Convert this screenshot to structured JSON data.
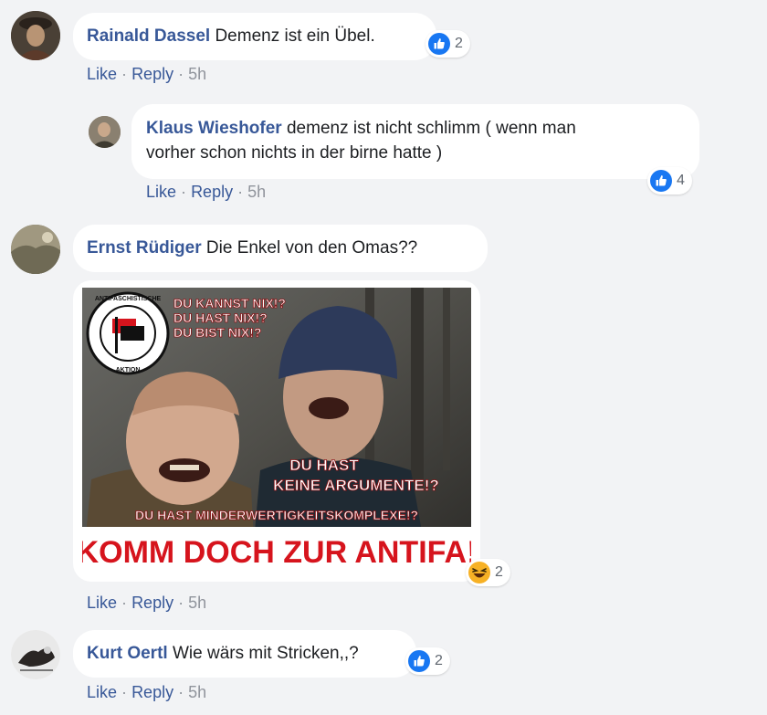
{
  "actions": {
    "like": "Like",
    "reply": "Reply",
    "separator": "·"
  },
  "colors": {
    "name": "#385898",
    "meta": "#90949c",
    "like_blue": "#1877f2",
    "bubble": "#ffffff",
    "page": "#f2f3f5"
  },
  "comments": [
    {
      "author": "Rainald Dassel",
      "text": "Demenz ist ein Übel.",
      "reaction": "like",
      "reaction_count": "2",
      "time": "5h"
    },
    {
      "author": "Klaus Wieshofer",
      "text_line1": "demenz ist nicht schlimm ( wenn man",
      "text_line2": "vorher schon nichts in der birne hatte )",
      "reaction": "like",
      "reaction_count": "4",
      "time": "5h"
    },
    {
      "author": "Ernst Rüdiger",
      "text": "Die Enkel von den Omas??",
      "reaction": "haha",
      "reaction_count": "2",
      "time": "5h",
      "image": {
        "logo_top": "ANTIFASCHISTISCHE",
        "logo_bottom": "AKTION",
        "top_lines": [
          "DU KANNST NIX!?",
          "DU HAST NIX!?",
          "DU BIST NIX!?"
        ],
        "mid_lines": [
          "DU HAST",
          "KEINE ARGUMENTE!?"
        ],
        "low_line": "DU HAST MINDERWERTIGKEITSKOMPLEXE!?",
        "bottom_line": "KOMM DOCH ZUR ANTIFA!"
      }
    },
    {
      "author": "Kurt Oertl",
      "text": "Wie wärs mit Stricken,,?",
      "reaction": "like",
      "reaction_count": "2",
      "time": "5h"
    }
  ]
}
